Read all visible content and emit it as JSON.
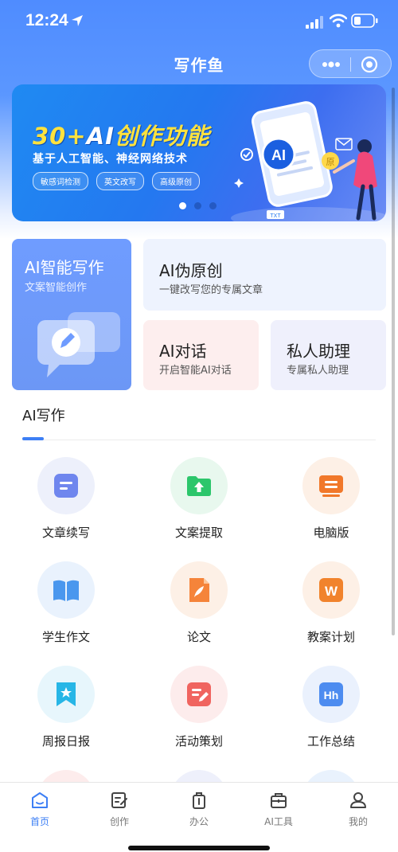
{
  "status": {
    "time": "12:24"
  },
  "nav": {
    "title": "写作鱼"
  },
  "banner": {
    "headline_num": "30+",
    "headline_ai": "AI",
    "headline_rest": "创作功能",
    "subtitle": "基于人工智能、神经网络技术",
    "tags": [
      "敏感词检测",
      "英文改写",
      "高级原创"
    ],
    "illus_badge": "AI",
    "illus_file": "TXT",
    "illus_side": "原",
    "page_count": 3,
    "active_page": 0
  },
  "cards": {
    "ai_writing": {
      "title": "AI智能写作",
      "sub": "文案智能创作"
    },
    "rewrite": {
      "title": "AI伪原创",
      "sub": "一键改写您的专属文章"
    },
    "chat": {
      "title": "AI对话",
      "sub": "开启智能AI对话"
    },
    "assistant": {
      "title": "私人助理",
      "sub": "专属私人助理"
    }
  },
  "section": {
    "title": "AI写作"
  },
  "grid": [
    {
      "label": "文章续写",
      "icon": "doc-lines-icon",
      "bg": "#edf0fb",
      "fg": "#6f86ee"
    },
    {
      "label": "文案提取",
      "icon": "folder-upload-icon",
      "bg": "#e8f8ee",
      "fg": "#2cc66b"
    },
    {
      "label": "电脑版",
      "icon": "monitor-icon",
      "bg": "#fdf0e6",
      "fg": "#f1782a"
    },
    {
      "label": "学生作文",
      "icon": "open-book-icon",
      "bg": "#e9f2fd",
      "fg": "#4a97ee"
    },
    {
      "label": "论文",
      "icon": "quill-doc-icon",
      "bg": "#fdf0e6",
      "fg": "#f5843a"
    },
    {
      "label": "教案计划",
      "icon": "w-doc-icon",
      "bg": "#fdf0e6",
      "fg": "#f1832c"
    },
    {
      "label": "周报日报",
      "icon": "bookmark-star-icon",
      "bg": "#e7f6fc",
      "fg": "#27b6e6"
    },
    {
      "label": "活动策划",
      "icon": "edit-doc-icon",
      "bg": "#fdecec",
      "fg": "#f0645f"
    },
    {
      "label": "工作总结",
      "icon": "hh-doc-icon",
      "bg": "#eaf1fd",
      "fg": "#4d8cf0"
    }
  ],
  "tabs": [
    {
      "label": "首页",
      "icon": "home-icon"
    },
    {
      "label": "创作",
      "icon": "create-icon"
    },
    {
      "label": "办公",
      "icon": "office-icon"
    },
    {
      "label": "AI工具",
      "icon": "toolbox-icon"
    },
    {
      "label": "我的",
      "icon": "profile-icon"
    }
  ],
  "colors": {
    "accent": "#3d7ff5",
    "header": "#4f8cff",
    "banner_headline": "#ffe23d"
  }
}
